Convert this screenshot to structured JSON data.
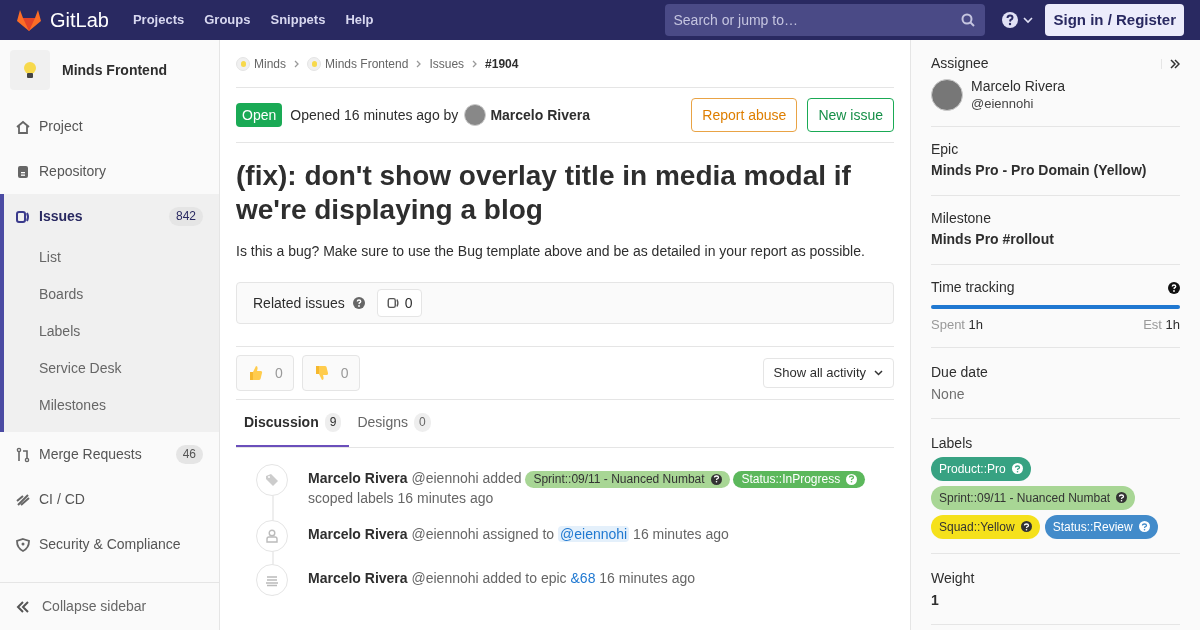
{
  "topbar": {
    "brand": "GitLab",
    "nav": [
      "Projects",
      "Groups",
      "Snippets",
      "Help"
    ],
    "search": {
      "placeholder": "Search or jump to…"
    },
    "sign_in": "Sign in / Register"
  },
  "sidebar": {
    "project": "Minds Frontend",
    "items": [
      {
        "label": "Project",
        "selected": false
      },
      {
        "label": "Repository",
        "selected": false
      },
      {
        "label": "Issues",
        "count": "842",
        "selected": true,
        "children": [
          {
            "label": "List"
          },
          {
            "label": "Boards"
          },
          {
            "label": "Labels"
          },
          {
            "label": "Service Desk"
          },
          {
            "label": "Milestones"
          }
        ]
      },
      {
        "label": "Merge Requests",
        "count": "46",
        "selected": false
      },
      {
        "label": "CI / CD",
        "selected": false
      },
      {
        "label": "Security & Compliance",
        "selected": false
      }
    ],
    "collapse": "Collapse sidebar"
  },
  "breadcrumbs": [
    {
      "label": "Minds",
      "avatar": true,
      "current": false
    },
    {
      "label": "Minds Frontend",
      "avatar": true,
      "current": false
    },
    {
      "label": "Issues",
      "avatar": false,
      "current": false
    },
    {
      "label": "#1904",
      "avatar": false,
      "current": true
    }
  ],
  "issue": {
    "status": "Open",
    "opened": "Opened 16 minutes ago by",
    "author": "Marcelo Rivera",
    "buttons": [
      {
        "label": "Report abuse",
        "kind": "warning"
      },
      {
        "label": "New issue",
        "kind": "success"
      }
    ],
    "title": "(fix): don't show overlay title in media modal if we're displaying a blog",
    "description": "Is this a bug? Make sure to use the Bug template above and be as detailed in your report as possible.",
    "related": {
      "label": "Related issues",
      "count": "0"
    },
    "reactions": [
      {
        "kind": "thumbsup",
        "count": "0"
      },
      {
        "kind": "thumbsdown",
        "count": "0"
      }
    ],
    "activity_filter": "Show all activity",
    "tabs": [
      {
        "label": "Discussion",
        "count": "9",
        "selected": true
      },
      {
        "label": "Designs",
        "count": "0",
        "selected": false
      }
    ],
    "timeline": [
      {
        "kind": "labels",
        "author": "Marcelo Rivera",
        "handle": "@eiennohi",
        "action": "added",
        "labels": [
          {
            "text": "Sprint::09/11 - Nuanced Numbat",
            "color": "#a8d695"
          },
          {
            "text": "Status::InProgress",
            "color": "#5cb85c"
          }
        ],
        "after": "scoped labels",
        "time": "16 minutes ago"
      },
      {
        "kind": "mention",
        "author": "Marcelo Rivera",
        "handle": "@eiennohi",
        "action": "assigned to",
        "target": "@eiennohi",
        "time": "16 minutes ago"
      },
      {
        "kind": "link",
        "author": "Marcelo Rivera",
        "handle": "@eiennohi",
        "action": "added to epic",
        "target": "&68",
        "time": "16 minutes ago"
      }
    ]
  },
  "right_sidebar": {
    "assignee": {
      "heading": "Assignee",
      "name": "Marcelo Rivera",
      "handle": "@eiennohi"
    },
    "epic": {
      "heading": "Epic",
      "value": "Minds Pro - Pro Domain (Yellow)"
    },
    "milestone": {
      "heading": "Milestone",
      "value": "Minds Pro #rollout"
    },
    "time_tracking": {
      "heading": "Time tracking",
      "level": 1,
      "spent_label": "Spent",
      "spent": "1h",
      "est_label": "Est",
      "est": "1h"
    },
    "due_date": {
      "heading": "Due date",
      "value": "None"
    },
    "labels": {
      "heading": "Labels",
      "items": [
        {
          "text": "Product::Pro",
          "color": "#37a282"
        },
        {
          "text": "Sprint::09/11 - Nuanced Numbat",
          "color": "#a8d695"
        },
        {
          "text": "Squad::Yellow",
          "color": "#f5e11b"
        },
        {
          "text": "Status::Review",
          "color": "#428bca"
        }
      ]
    },
    "weight": {
      "heading": "Weight",
      "value": "1"
    }
  }
}
